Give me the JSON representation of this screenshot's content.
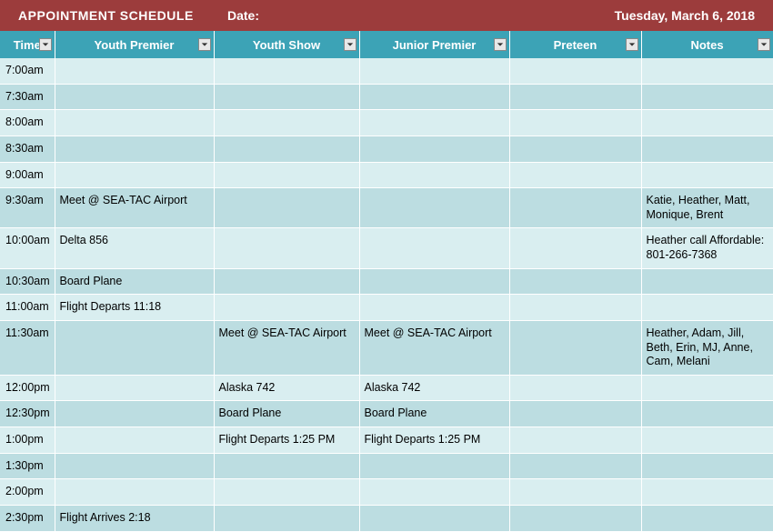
{
  "header": {
    "title": "APPOINTMENT SCHEDULE",
    "date_label": "Date:",
    "date_value": "Tuesday, March 6, 2018"
  },
  "columns": [
    {
      "key": "time",
      "label": "Time",
      "cls": "col-time",
      "filter": true
    },
    {
      "key": "yp",
      "label": "Youth Premier",
      "cls": "col-yp",
      "filter": true
    },
    {
      "key": "ys",
      "label": "Youth Show",
      "cls": "col-ys",
      "filter": true
    },
    {
      "key": "jp",
      "label": "Junior Premier",
      "cls": "col-jp",
      "filter": true
    },
    {
      "key": "pt",
      "label": "Preteen",
      "cls": "col-pt",
      "filter": true
    },
    {
      "key": "notes",
      "label": "Notes",
      "cls": "col-notes",
      "filter": true
    }
  ],
  "rows": [
    {
      "time": "7:00am",
      "yp": "",
      "ys": "",
      "jp": "",
      "pt": "",
      "notes": ""
    },
    {
      "time": "7:30am",
      "yp": "",
      "ys": "",
      "jp": "",
      "pt": "",
      "notes": ""
    },
    {
      "time": "8:00am",
      "yp": "",
      "ys": "",
      "jp": "",
      "pt": "",
      "notes": ""
    },
    {
      "time": "8:30am",
      "yp": "",
      "ys": "",
      "jp": "",
      "pt": "",
      "notes": ""
    },
    {
      "time": "9:00am",
      "yp": "",
      "ys": "",
      "jp": "",
      "pt": "",
      "notes": ""
    },
    {
      "time": "9:30am",
      "yp": "Meet @ SEA-TAC Airport",
      "ys": "",
      "jp": "",
      "pt": "",
      "notes": "Katie, Heather, Matt, Monique, Brent"
    },
    {
      "time": "10:00am",
      "yp": "Delta 856",
      "ys": "",
      "jp": "",
      "pt": "",
      "notes": "Heather call Affordable:  801-266-7368"
    },
    {
      "time": "10:30am",
      "yp": "Board Plane",
      "ys": "",
      "jp": "",
      "pt": "",
      "notes": ""
    },
    {
      "time": "11:00am",
      "yp": "Flight Departs 11:18",
      "ys": "",
      "jp": "",
      "pt": "",
      "notes": ""
    },
    {
      "time": "11:30am",
      "yp": "",
      "ys": "Meet @ SEA-TAC Airport",
      "jp": "Meet @ SEA-TAC Airport",
      "pt": "",
      "notes": "Heather, Adam, Jill, Beth, Erin, MJ, Anne, Cam, Melani"
    },
    {
      "time": "12:00pm",
      "yp": "",
      "ys": "Alaska 742",
      "jp": "Alaska 742",
      "pt": "",
      "notes": ""
    },
    {
      "time": "12:30pm",
      "yp": "",
      "ys": "Board Plane",
      "jp": "Board Plane",
      "pt": "",
      "notes": ""
    },
    {
      "time": "1:00pm",
      "yp": "",
      "ys": "Flight Departs 1:25 PM",
      "jp": "Flight Departs 1:25 PM",
      "pt": "",
      "notes": ""
    },
    {
      "time": "1:30pm",
      "yp": "",
      "ys": "",
      "jp": "",
      "pt": "",
      "notes": ""
    },
    {
      "time": "2:00pm",
      "yp": "",
      "ys": "",
      "jp": "",
      "pt": "",
      "notes": ""
    },
    {
      "time": "2:30pm",
      "yp": "Flight Arrives 2:18",
      "ys": "",
      "jp": "",
      "pt": "",
      "notes": ""
    }
  ],
  "truncate_cols": [
    "ys"
  ]
}
